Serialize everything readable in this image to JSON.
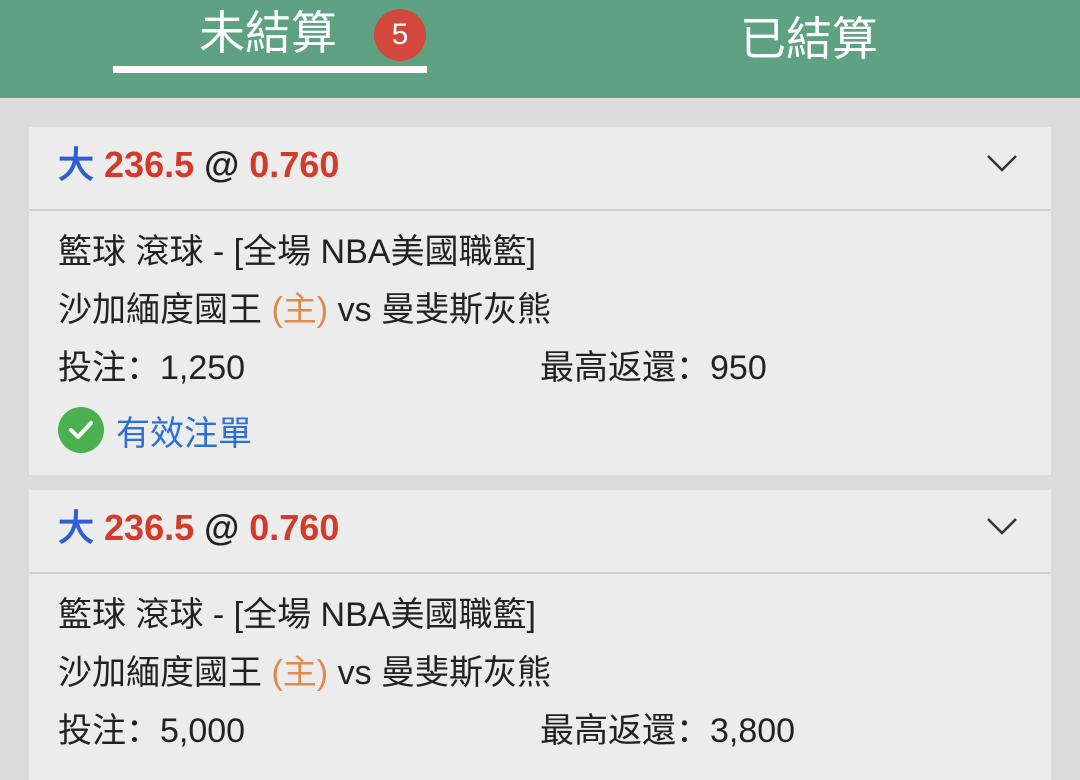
{
  "tabs": {
    "unsettled_label": "未結算",
    "unsettled_count": "5",
    "settled_label": "已結算"
  },
  "bets": [
    {
      "direction": "大",
      "line": "236.5",
      "at": "@",
      "odds": "0.760",
      "league": "籃球 滾球 - [全場 NBA美國職籃]",
      "home_team": "沙加緬度國王",
      "home_tag": "(主)",
      "vs": "vs",
      "away_team": "曼斐斯灰熊",
      "stake_label": "投注：",
      "stake": "1,250",
      "return_label": "最高返還：",
      "max_return": "950",
      "status": "有效注單"
    },
    {
      "direction": "大",
      "line": "236.5",
      "at": "@",
      "odds": "0.760",
      "league": "籃球 滾球 - [全場 NBA美國職籃]",
      "home_team": "沙加緬度國王",
      "home_tag": "(主)",
      "vs": "vs",
      "away_team": "曼斐斯灰熊",
      "stake_label": "投注：",
      "stake": "5,000",
      "return_label": "最高返還：",
      "max_return": "3,800"
    }
  ],
  "colors": {
    "header_green": "#5ea283",
    "badge_red": "#d2483c",
    "odds_red": "#d23a2a",
    "direction_blue": "#2e5fd0",
    "home_orange": "#e0894a",
    "status_green": "#4caf50"
  }
}
